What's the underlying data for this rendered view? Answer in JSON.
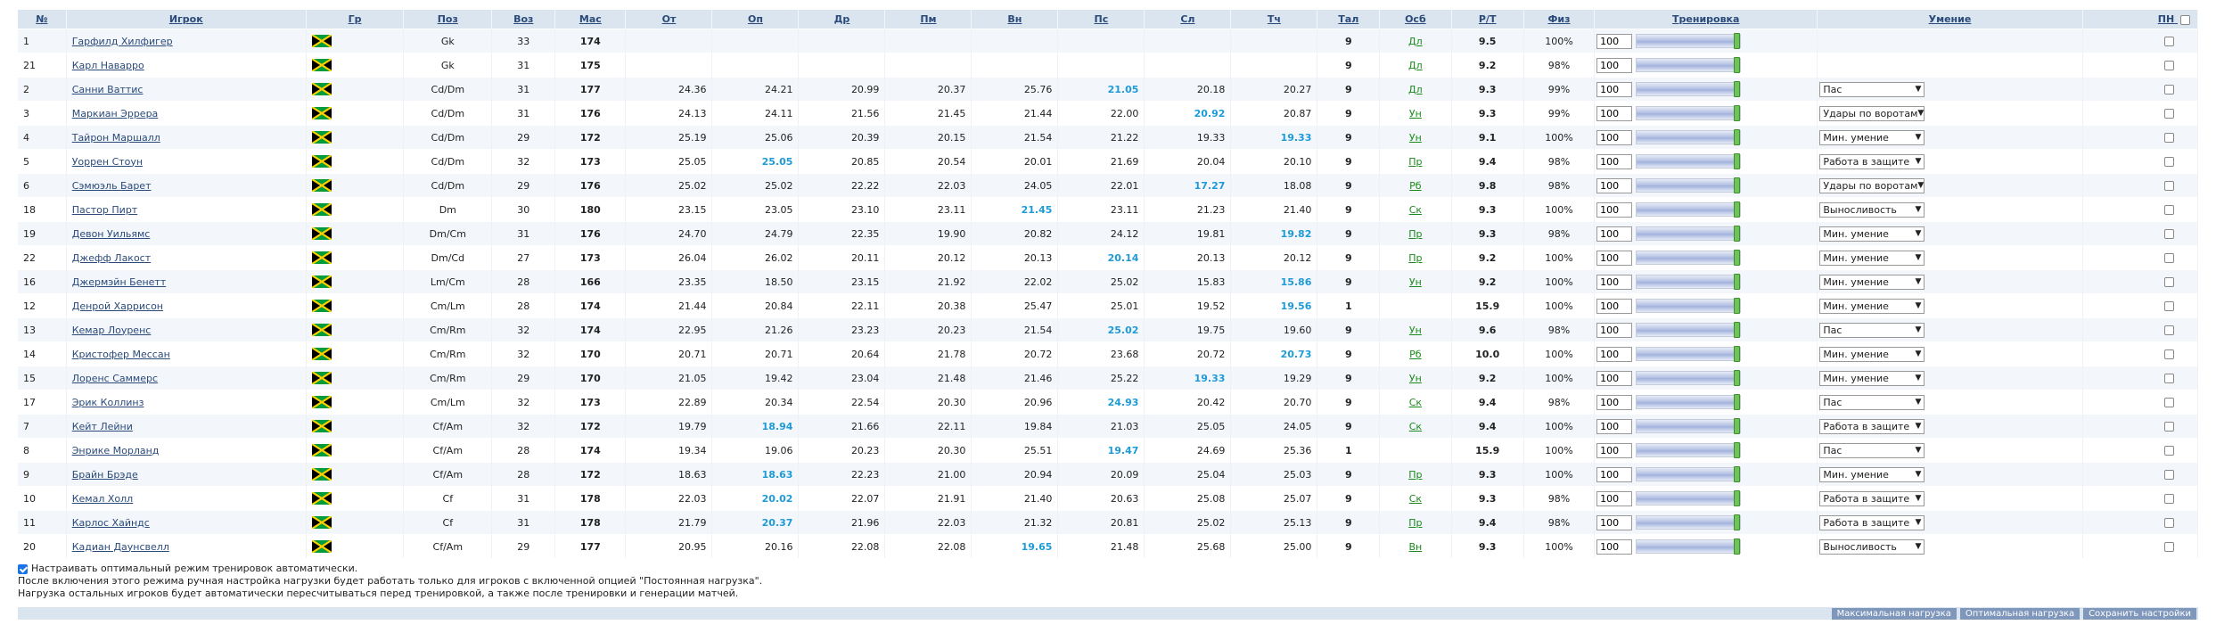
{
  "headers": {
    "num": "№",
    "player": "Игрок",
    "nat": "Гр",
    "pos": "Поз",
    "age": "Воз",
    "mas": "Мас",
    "ot": "От",
    "op": "Оп",
    "dr": "Др",
    "pm": "Пм",
    "vn": "Вн",
    "ps": "Пс",
    "sl": "Сл",
    "tch": "Тч",
    "tal": "Тал",
    "osb": "Осб",
    "rt": "Р/Т",
    "fiz": "Физ",
    "training": "Тренировка",
    "skill": "Умение",
    "pn": "ПН"
  },
  "players": [
    {
      "num": "1",
      "name": "Гарфилд Хилфигер",
      "pos": "Gk",
      "age": "33",
      "mas": "174",
      "ot": "",
      "op": "",
      "dr": "",
      "pm": "",
      "vn": "",
      "ps": "",
      "sl": "",
      "tch": "",
      "tal": "9",
      "osb": "Дл",
      "rt": "9.5",
      "fiz": "100%",
      "train": "100",
      "load": 1.0,
      "skill": "",
      "hi": []
    },
    {
      "num": "21",
      "name": "Карл Наварро",
      "pos": "Gk",
      "age": "31",
      "mas": "175",
      "ot": "",
      "op": "",
      "dr": "",
      "pm": "",
      "vn": "",
      "ps": "",
      "sl": "",
      "tch": "",
      "tal": "9",
      "osb": "Дл",
      "rt": "9.2",
      "fiz": "98%",
      "train": "100",
      "load": 1.0,
      "skill": "",
      "hi": []
    },
    {
      "num": "2",
      "name": "Санни Ваттис",
      "pos": "Cd/Dm",
      "age": "31",
      "mas": "177",
      "ot": "24.36",
      "op": "24.21",
      "dr": "20.99",
      "pm": "20.37",
      "vn": "25.76",
      "ps": "21.05",
      "sl": "20.18",
      "tch": "20.27",
      "tal": "9",
      "osb": "Дл",
      "rt": "9.3",
      "fiz": "99%",
      "train": "100",
      "load": 1.0,
      "skill": "Пас",
      "hi": [
        "ps"
      ]
    },
    {
      "num": "3",
      "name": "Маркиан Эррера",
      "pos": "Cd/Dm",
      "age": "31",
      "mas": "176",
      "ot": "24.13",
      "op": "24.11",
      "dr": "21.56",
      "pm": "21.45",
      "vn": "21.44",
      "ps": "22.00",
      "sl": "20.92",
      "tch": "20.87",
      "tal": "9",
      "osb": "Ун",
      "rt": "9.3",
      "fiz": "99%",
      "train": "100",
      "load": 1.0,
      "skill": "Удары по воротам",
      "hi": [
        "sl"
      ]
    },
    {
      "num": "4",
      "name": "Тайрон Маршалл",
      "pos": "Cd/Dm",
      "age": "29",
      "mas": "172",
      "ot": "25.19",
      "op": "25.06",
      "dr": "20.39",
      "pm": "20.15",
      "vn": "21.54",
      "ps": "21.22",
      "sl": "19.33",
      "tch": "19.33",
      "tal": "9",
      "osb": "Ун",
      "rt": "9.1",
      "fiz": "100%",
      "train": "100",
      "load": 1.0,
      "skill": "Мин. умение",
      "hi": [
        "tch"
      ]
    },
    {
      "num": "5",
      "name": "Уоррен Стоун",
      "pos": "Cd/Dm",
      "age": "32",
      "mas": "173",
      "ot": "25.05",
      "op": "25.05",
      "dr": "20.85",
      "pm": "20.54",
      "vn": "20.01",
      "ps": "21.69",
      "sl": "20.04",
      "tch": "20.10",
      "tal": "9",
      "osb": "Пр",
      "rt": "9.4",
      "fiz": "98%",
      "train": "100",
      "load": 1.0,
      "skill": "Работа в защите",
      "hi": [
        "op"
      ]
    },
    {
      "num": "6",
      "name": "Сэмюэль Барет",
      "pos": "Cd/Dm",
      "age": "29",
      "mas": "176",
      "ot": "25.02",
      "op": "25.02",
      "dr": "22.22",
      "pm": "22.03",
      "vn": "24.05",
      "ps": "22.01",
      "sl": "17.27",
      "tch": "18.08",
      "tal": "9",
      "osb": "Рб",
      "rt": "9.8",
      "fiz": "98%",
      "train": "100",
      "load": 1.0,
      "skill": "Удары по воротам",
      "hi": [
        "sl"
      ]
    },
    {
      "num": "18",
      "name": "Пастор Пирт",
      "pos": "Dm",
      "age": "30",
      "mas": "180",
      "ot": "23.15",
      "op": "23.05",
      "dr": "23.10",
      "pm": "23.11",
      "vn": "21.45",
      "ps": "23.11",
      "sl": "21.23",
      "tch": "21.40",
      "tal": "9",
      "osb": "Ск",
      "rt": "9.3",
      "fiz": "100%",
      "train": "100",
      "load": 1.0,
      "skill": "Выносливость",
      "hi": [
        "vn"
      ]
    },
    {
      "num": "19",
      "name": "Девон Уильямс",
      "pos": "Dm/Cm",
      "age": "31",
      "mas": "176",
      "ot": "24.70",
      "op": "24.79",
      "dr": "22.35",
      "pm": "19.90",
      "vn": "20.82",
      "ps": "24.12",
      "sl": "19.81",
      "tch": "19.82",
      "tal": "9",
      "osb": "Пр",
      "rt": "9.3",
      "fiz": "98%",
      "train": "100",
      "load": 1.0,
      "skill": "Мин. умение",
      "hi": [
        "tch"
      ]
    },
    {
      "num": "22",
      "name": "Джефф Лакост",
      "pos": "Dm/Cd",
      "age": "27",
      "mas": "173",
      "ot": "26.04",
      "op": "26.02",
      "dr": "20.11",
      "pm": "20.12",
      "vn": "20.13",
      "ps": "20.14",
      "sl": "20.13",
      "tch": "20.12",
      "tal": "9",
      "osb": "Пр",
      "rt": "9.2",
      "fiz": "100%",
      "train": "100",
      "load": 1.0,
      "skill": "Мин. умение",
      "hi": [
        "ps"
      ]
    },
    {
      "num": "16",
      "name": "Джермэйн Бенетт",
      "pos": "Lm/Cm",
      "age": "28",
      "mas": "166",
      "ot": "23.35",
      "op": "18.50",
      "dr": "23.15",
      "pm": "21.92",
      "vn": "22.02",
      "ps": "25.02",
      "sl": "15.83",
      "tch": "15.86",
      "tal": "9",
      "osb": "Ун",
      "rt": "9.2",
      "fiz": "100%",
      "train": "100",
      "load": 1.0,
      "skill": "Мин. умение",
      "hi": [
        "tch"
      ]
    },
    {
      "num": "12",
      "name": "Денрой Харрисон",
      "pos": "Cm/Lm",
      "age": "28",
      "mas": "174",
      "ot": "21.44",
      "op": "20.84",
      "dr": "22.11",
      "pm": "20.38",
      "vn": "25.47",
      "ps": "25.01",
      "sl": "19.52",
      "tch": "19.56",
      "tal": "1",
      "osb": "",
      "rt": "15.9",
      "fiz": "100%",
      "train": "100",
      "load": 1.0,
      "skill": "Мин. умение",
      "hi": [
        "tch"
      ]
    },
    {
      "num": "13",
      "name": "Кемар Лоуренс",
      "pos": "Cm/Rm",
      "age": "32",
      "mas": "174",
      "ot": "22.95",
      "op": "21.26",
      "dr": "23.23",
      "pm": "20.23",
      "vn": "21.54",
      "ps": "25.02",
      "sl": "19.75",
      "tch": "19.60",
      "tal": "9",
      "osb": "Ун",
      "rt": "9.6",
      "fiz": "98%",
      "train": "100",
      "load": 1.0,
      "skill": "Пас",
      "hi": [
        "ps"
      ]
    },
    {
      "num": "14",
      "name": "Кристофер Мессан",
      "pos": "Cm/Rm",
      "age": "32",
      "mas": "170",
      "ot": "20.71",
      "op": "20.71",
      "dr": "20.64",
      "pm": "21.78",
      "vn": "20.72",
      "ps": "23.68",
      "sl": "20.72",
      "tch": "20.73",
      "tal": "9",
      "osb": "Рб",
      "rt": "10.0",
      "fiz": "100%",
      "train": "100",
      "load": 1.0,
      "skill": "Мин. умение",
      "hi": [
        "tch"
      ]
    },
    {
      "num": "15",
      "name": "Лоренс Саммерс",
      "pos": "Cm/Rm",
      "age": "29",
      "mas": "170",
      "ot": "21.05",
      "op": "19.42",
      "dr": "23.04",
      "pm": "21.48",
      "vn": "21.46",
      "ps": "25.22",
      "sl": "19.33",
      "tch": "19.29",
      "tal": "9",
      "osb": "Ун",
      "rt": "9.2",
      "fiz": "100%",
      "train": "100",
      "load": 1.0,
      "skill": "Мин. умение",
      "hi": [
        "sl"
      ]
    },
    {
      "num": "17",
      "name": "Эрик Коллинз",
      "pos": "Cm/Lm",
      "age": "32",
      "mas": "173",
      "ot": "22.89",
      "op": "20.34",
      "dr": "22.54",
      "pm": "20.30",
      "vn": "20.96",
      "ps": "24.93",
      "sl": "20.42",
      "tch": "20.70",
      "tal": "9",
      "osb": "Ск",
      "rt": "9.4",
      "fiz": "98%",
      "train": "100",
      "load": 1.0,
      "skill": "Пас",
      "hi": [
        "ps"
      ]
    },
    {
      "num": "7",
      "name": "Кейт Лейни",
      "pos": "Cf/Am",
      "age": "32",
      "mas": "172",
      "ot": "19.79",
      "op": "18.94",
      "dr": "21.66",
      "pm": "22.11",
      "vn": "19.84",
      "ps": "21.03",
      "sl": "25.05",
      "tch": "24.05",
      "tal": "9",
      "osb": "Ск",
      "rt": "9.4",
      "fiz": "100%",
      "train": "100",
      "load": 1.0,
      "skill": "Работа в защите",
      "hi": [
        "op"
      ]
    },
    {
      "num": "8",
      "name": "Энрике Морланд",
      "pos": "Cf/Am",
      "age": "28",
      "mas": "174",
      "ot": "19.34",
      "op": "19.06",
      "dr": "20.23",
      "pm": "20.30",
      "vn": "25.51",
      "ps": "19.47",
      "sl": "24.69",
      "tch": "25.36",
      "tal": "1",
      "osb": "",
      "rt": "15.9",
      "fiz": "100%",
      "train": "100",
      "load": 1.0,
      "skill": "Пас",
      "hi": [
        "ps"
      ]
    },
    {
      "num": "9",
      "name": "Брайн Брэде",
      "pos": "Cf/Am",
      "age": "28",
      "mas": "172",
      "ot": "18.63",
      "op": "18.63",
      "dr": "22.23",
      "pm": "21.00",
      "vn": "20.94",
      "ps": "20.09",
      "sl": "25.04",
      "tch": "25.03",
      "tal": "9",
      "osb": "Пр",
      "rt": "9.3",
      "fiz": "100%",
      "train": "100",
      "load": 1.0,
      "skill": "Мин. умение",
      "hi": [
        "op"
      ]
    },
    {
      "num": "10",
      "name": "Кемал Холл",
      "pos": "Cf",
      "age": "31",
      "mas": "178",
      "ot": "22.03",
      "op": "20.02",
      "dr": "22.07",
      "pm": "21.91",
      "vn": "21.40",
      "ps": "20.63",
      "sl": "25.08",
      "tch": "25.07",
      "tal": "9",
      "osb": "Ск",
      "rt": "9.3",
      "fiz": "98%",
      "train": "100",
      "load": 1.0,
      "skill": "Работа в защите",
      "hi": [
        "op"
      ]
    },
    {
      "num": "11",
      "name": "Карлос Хайндс",
      "pos": "Cf",
      "age": "31",
      "mas": "178",
      "ot": "21.79",
      "op": "20.37",
      "dr": "21.96",
      "pm": "22.03",
      "vn": "21.32",
      "ps": "20.81",
      "sl": "25.02",
      "tch": "25.13",
      "tal": "9",
      "osb": "Пр",
      "rt": "9.4",
      "fiz": "98%",
      "train": "100",
      "load": 1.0,
      "skill": "Работа в защите",
      "hi": [
        "op"
      ]
    },
    {
      "num": "20",
      "name": "Кадиан Даунсвелл",
      "pos": "Cf/Am",
      "age": "29",
      "mas": "177",
      "ot": "20.95",
      "op": "20.16",
      "dr": "22.08",
      "pm": "22.08",
      "vn": "19.65",
      "ps": "21.48",
      "sl": "25.68",
      "tch": "25.00",
      "tal": "9",
      "osb": "Вн",
      "rt": "9.3",
      "fiz": "100%",
      "train": "100",
      "load": 1.0,
      "skill": "Выносливость",
      "hi": [
        "vn"
      ]
    }
  ],
  "footer": {
    "auto_label": "Настраивать оптимальный режим тренировок автоматически.",
    "note1": "После включения этого режима ручная настройка нагрузки будет работать только для игроков с включенной опцией \"Постоянная нагрузка\".",
    "note2": "Нагрузка остальных игроков будет автоматически пересчитываться перед тренировкой, а также после тренировки и генерации матчей."
  },
  "buttons": {
    "max": "Максимальная нагрузка",
    "opt": "Оптимальная нагрузка",
    "save": "Сохранить настройки"
  },
  "colors": {
    "header_bg": "#dbe5ef",
    "highlight": "#1e9bd7",
    "link": "#2a4a7a",
    "osb": "#1a8a1a",
    "knob": "#6ec45a"
  }
}
